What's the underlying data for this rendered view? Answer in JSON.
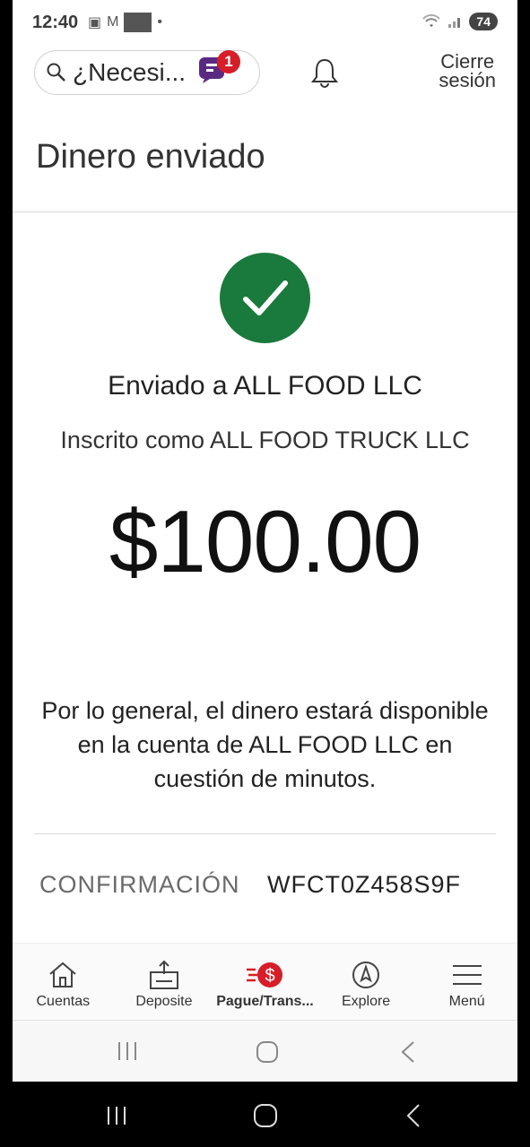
{
  "status_bar": {
    "time": "12:40",
    "app_badge": "WF",
    "battery": "74"
  },
  "header": {
    "search_placeholder": "¿Necesi...",
    "notification_count": "1",
    "logout_label_line1": "Cierre",
    "logout_label_line2": "sesión"
  },
  "page": {
    "title": "Dinero enviado"
  },
  "confirmation": {
    "sent_to": "Enviado a ALL FOOD LLC",
    "enrolled_as": "Inscrito como ALL FOOD TRUCK LLC",
    "amount": "$100.00",
    "availability": "Por lo general, el dinero estará disponible en la cuenta de ALL FOOD LLC en cuestión de minutos.",
    "confirmation_label": "CONFIRMACIÓN",
    "confirmation_number": "WFCT0Z458S9F"
  },
  "bottom_nav": {
    "items": [
      {
        "label": "Cuentas",
        "icon": "home-icon"
      },
      {
        "label": "Deposite",
        "icon": "deposit-icon"
      },
      {
        "label": "Pague/Trans...",
        "icon": "pay-transfer-icon"
      },
      {
        "label": "Explore",
        "icon": "compass-icon"
      },
      {
        "label": "Menú",
        "icon": "menu-icon"
      }
    ],
    "active_index": 2
  },
  "colors": {
    "success_green": "#1a7a3e",
    "brand_red": "#d71e28",
    "brand_purple": "#5a2a82"
  }
}
